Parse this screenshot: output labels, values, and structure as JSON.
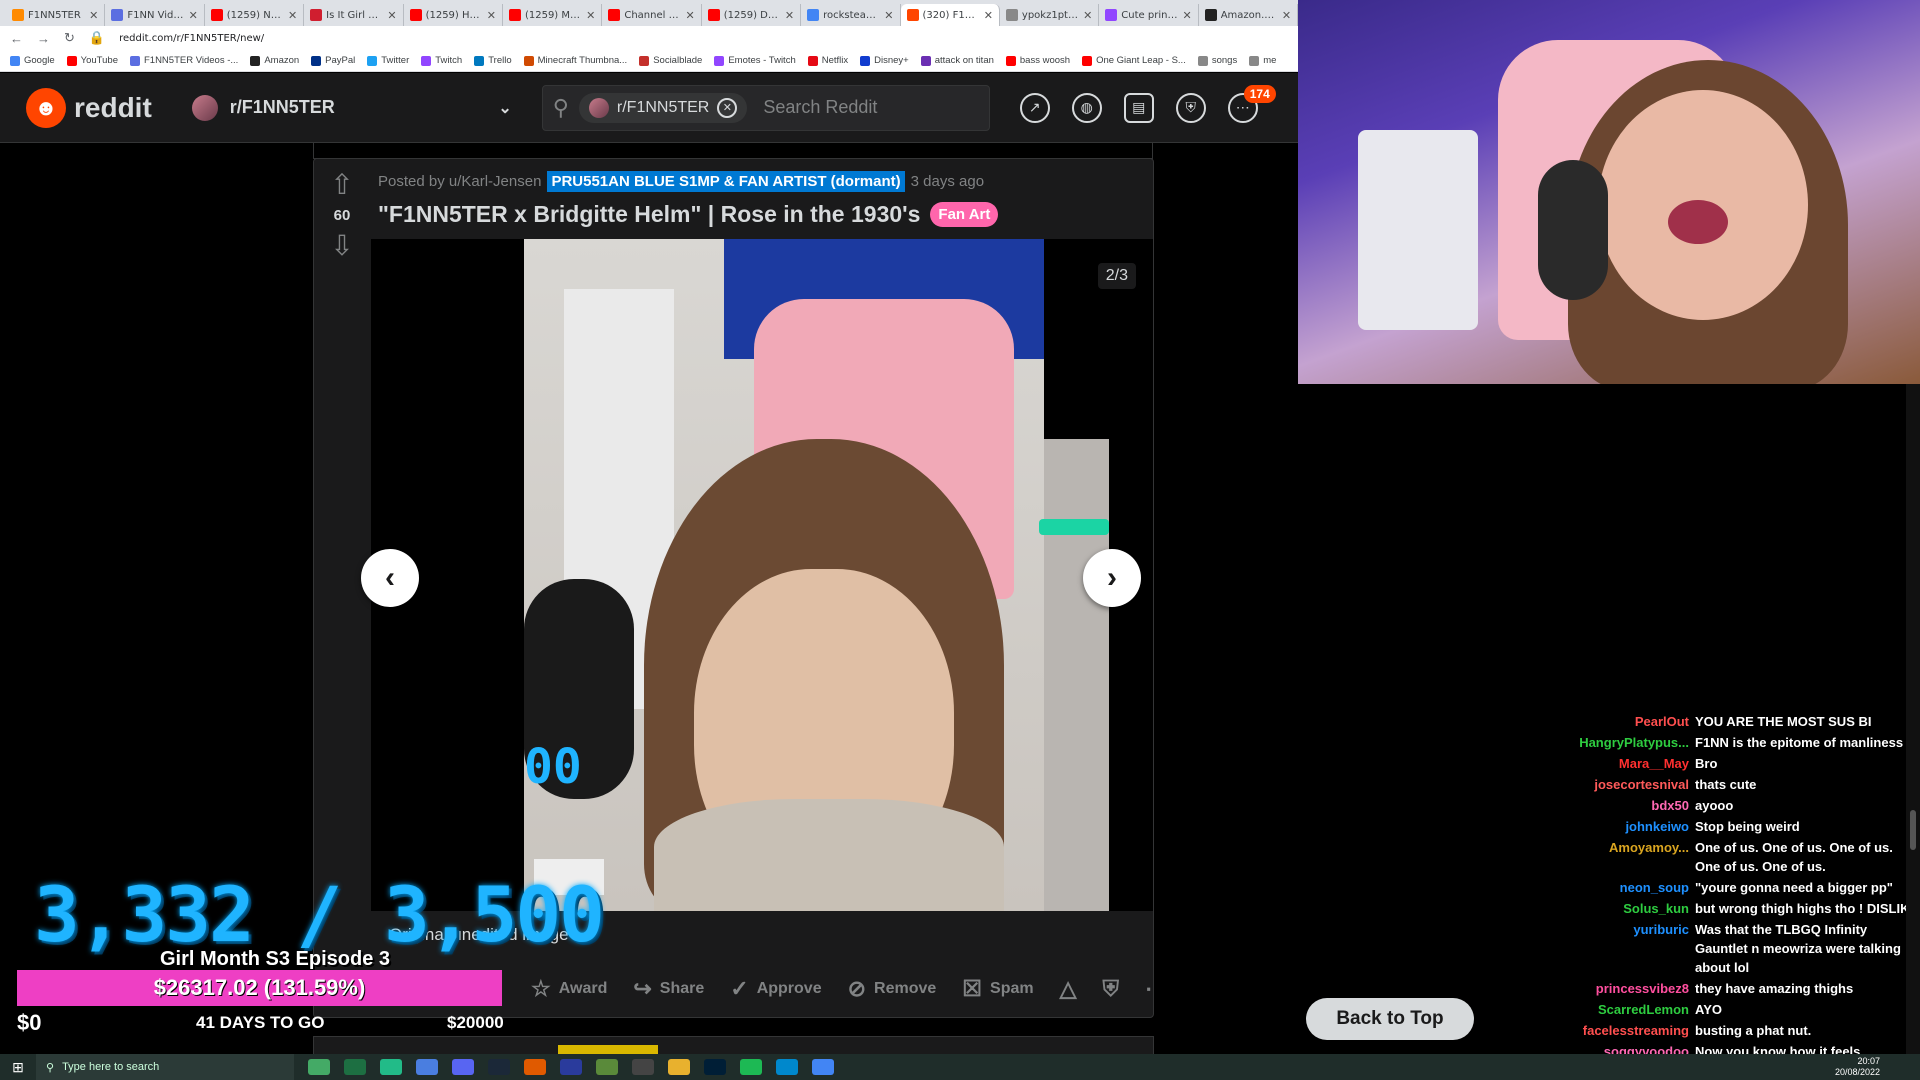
{
  "browser": {
    "tabs": [
      {
        "label": "F1NN5TER",
        "color": "#ff8a00"
      },
      {
        "label": "F1NN Videos",
        "color": "#5b6ee1"
      },
      {
        "label": "(1259) Never",
        "color": "#ff0000"
      },
      {
        "label": "Is It Girl Mon",
        "color": "#d01e2f"
      },
      {
        "label": "(1259) How t",
        "color": "#ff0000"
      },
      {
        "label": "(1259) My Li",
        "color": "#ff0000"
      },
      {
        "label": "Channel anal",
        "color": "#ff0000"
      },
      {
        "label": "(1259) Desig",
        "color": "#ff0000"
      },
      {
        "label": "rockstead ry",
        "color": "#4285f4"
      },
      {
        "label": "(320) F1NN5",
        "color": "#ff4500",
        "active": true
      },
      {
        "label": "ypokz1ptbo",
        "color": "#888888"
      },
      {
        "label": "Cute princes",
        "color": "#9146ff"
      },
      {
        "label": "Amazon.co.u",
        "color": "#222222"
      }
    ],
    "url": "reddit.com/r/F1NN5TER/new/",
    "bookmarks": [
      {
        "label": "Google",
        "color": "#4285f4"
      },
      {
        "label": "YouTube",
        "color": "#ff0000"
      },
      {
        "label": "F1NN5TER Videos -...",
        "color": "#5b6ee1"
      },
      {
        "label": "Amazon",
        "color": "#222222"
      },
      {
        "label": "PayPal",
        "color": "#003087"
      },
      {
        "label": "Twitter",
        "color": "#1da1f2"
      },
      {
        "label": "Twitch",
        "color": "#9146ff"
      },
      {
        "label": "Trello",
        "color": "#0079bf"
      },
      {
        "label": "Minecraft Thumbna...",
        "color": "#d04a02"
      },
      {
        "label": "Socialblade",
        "color": "#c4302b"
      },
      {
        "label": "Emotes - Twitch",
        "color": "#9146ff"
      },
      {
        "label": "Netflix",
        "color": "#e50914"
      },
      {
        "label": "Disney+",
        "color": "#113ccf"
      },
      {
        "label": "attack on titan",
        "color": "#6b2fb3"
      },
      {
        "label": "bass woosh",
        "color": "#ff0000"
      },
      {
        "label": "One Giant Leap - S...",
        "color": "#ff0000"
      },
      {
        "label": "songs",
        "color": "#888888"
      },
      {
        "label": "me",
        "color": "#888888"
      }
    ]
  },
  "header": {
    "logo_text": "reddit",
    "subreddit": "r/F1NN5TER",
    "search_chip": "r/F1NN5TER",
    "search_placeholder": "Search Reddit",
    "chat_badge": "174"
  },
  "post": {
    "score": "60",
    "posted_by": "Posted by u/Karl-Jensen",
    "user_flair": "PRU551AN BLUE S1MP & FAN ARTIST (dormant)",
    "time": "3 days ago",
    "title": "\"F1NN5TER x Bridgitte Helm\" | Rose in the 1930's",
    "flair": "Fan Art",
    "gallery_counter": "2/3",
    "caption": "Original unedited image",
    "actions": {
      "award": "Award",
      "share": "Share",
      "approve": "Approve",
      "remove": "Remove",
      "spam": "Spam"
    }
  },
  "overlay": {
    "counter": "3,332 / 3,500",
    "goal_title": "Girl Month S3 Episode 3",
    "goal_amount": "$26317.02 (131.59%)",
    "goal_progress": 1.0,
    "goal_min": "$0",
    "goal_days": "41 DAYS TO GO",
    "goal_max": "$20000"
  },
  "chat": [
    {
      "name": "PearlOut",
      "color": "#ff4f4f",
      "text": "YOU ARE THE MOST SUS BI"
    },
    {
      "name": "HangryPlatypus...",
      "color": "#2ecc40",
      "text": "F1NN is the epitome of manliness"
    },
    {
      "name": "Mara__May",
      "color": "#ff3030",
      "text": "Bro"
    },
    {
      "name": "josecortesnival",
      "color": "#ff5a5a",
      "text": "thats cute"
    },
    {
      "name": "bdx50",
      "color": "#ff69b4",
      "text": "ayooo"
    },
    {
      "name": "johnkeiwo",
      "color": "#1e90ff",
      "text": "Stop being weird"
    },
    {
      "name": "Amoyamoy...",
      "color": "#daa520",
      "text": "One of us. One of us. One of us. One of us. One of us."
    },
    {
      "name": "neon_soup",
      "color": "#1e90ff",
      "text": "\"youre gonna need a bigger pp\""
    },
    {
      "name": "Solus_kun",
      "color": "#2ecc40",
      "text": "but wrong thigh highs tho ! DISLIK"
    },
    {
      "name": "yuriburic",
      "color": "#1e90ff",
      "text": "Was that the TLBGQ Infinity Gauntlet n meowriza were talking about lol"
    },
    {
      "name": "princessvibez8",
      "color": "#ff4f9f",
      "text": "they have amazing thighs"
    },
    {
      "name": "ScarredLemon",
      "color": "#2ecc40",
      "text": "AYO"
    },
    {
      "name": "facelesstreaming",
      "color": "#ff4f4f",
      "text": "busting a phat nut."
    },
    {
      "name": "soggyvoodoo",
      "color": "#ff69b4",
      "text": "Now you know how it feels"
    }
  ],
  "back_to_top": "Back to Top",
  "taskbar": {
    "search_placeholder": "Type here to search",
    "time": "20:07",
    "date": "20/08/2022"
  }
}
